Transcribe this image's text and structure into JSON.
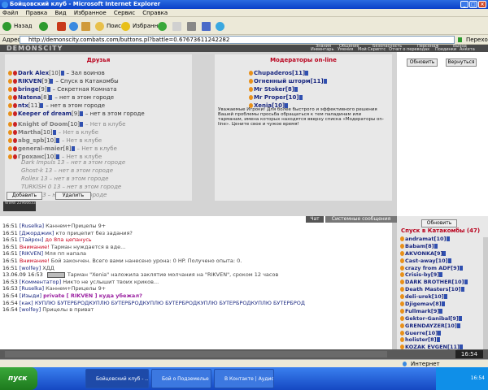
{
  "window": {
    "title": "Бойцовский клуб - Microsoft Internet Explorer"
  },
  "menu": [
    "Файл",
    "Правка",
    "Вид",
    "Избранное",
    "Сервис",
    "Справка"
  ],
  "toolbar": {
    "back": "Назад",
    "search": "Поиск",
    "favorites": "Избранное"
  },
  "address": {
    "label": "Адрес:",
    "url": "http://demonscity.combats.com/buttons.pl?battle=0.67673611242282",
    "go": "Переход"
  },
  "game_header": {
    "logo": "DEMONSCITY",
    "nav_top": [
      "Знания",
      "Общение",
      "Безопасность",
      "Персонаж",
      "Выход"
    ],
    "nav_bottom": [
      "Инвентарь",
      "Умения",
      "Мой Скриптс",
      "Отчет о переводах",
      "Поединки",
      "Анкета"
    ]
  },
  "friends": {
    "title": "Друзья",
    "online": [
      {
        "name": "Dark Alex",
        "lvl": "[10]",
        "loc": "– Зал воинов"
      },
      {
        "name": "RIKVEN",
        "lvl": "[9]",
        "loc": "– Спуск в Катакомбы"
      },
      {
        "name": "bringe",
        "lvl": "[9]",
        "loc": "– Секретная Комната"
      },
      {
        "name": "Natena",
        "lvl": "[8]",
        "loc": "– нет в этом городе"
      },
      {
        "name": "ntx",
        "lvl": "[11]",
        "loc": "– нет в этом городе"
      },
      {
        "name": "Keeper of dream",
        "lvl": "[9]",
        "loc": "– нет в этом городе"
      }
    ],
    "offline": [
      {
        "name": "Knight of Doom",
        "lvl": "[10]",
        "loc": "– Нет в клубе"
      },
      {
        "name": "Martha",
        "lvl": "[10]",
        "loc": "– Нет в клубе"
      },
      {
        "name": "abg_spb",
        "lvl": "[10]",
        "loc": "– Нет в клубе"
      },
      {
        "name": "general-maier",
        "lvl": "[8]",
        "loc": "– Нет в клубе"
      },
      {
        "name": "Гроханс",
        "lvl": "[10]",
        "loc": "– Нет в клубе"
      }
    ],
    "other": [
      {
        "name": "Dark Impuls",
        "lvl": " 13",
        "loc": "– нет в этом городе"
      },
      {
        "name": "Ghost-k",
        "lvl": " 13",
        "loc": "– нет в этом городе"
      },
      {
        "name": "Rollex",
        "lvl": " 13",
        "loc": "– нет в этом городе"
      },
      {
        "name": "TURKISH",
        "lvl": " 0 13",
        "loc": "– нет в этом городе"
      },
      {
        "name": "Zinok",
        "lvl": " 13",
        "loc": "– нет в этом городе"
      }
    ],
    "add_button": "Добавить",
    "remove_button": "Удалить",
    "counter": "WWW 22966633"
  },
  "moderators": {
    "title": "Модераторы on-line",
    "list": [
      "Chupaderos[11]",
      "Огненный шторм[11]",
      "Mr Stoker[8]",
      "Mr Proper[10]",
      "Xenia[10]"
    ],
    "note": "Уважаемые Игроки! Для более быстрого и эффективного решения Вашей проблемы просьба обращаться к тем паладинам или тарманам, имена которых находятся вверху списка «Модераторы on-line». Цените свое и чужое время!",
    "refresh_button": "Обновить",
    "back_button": "Вернуться"
  },
  "tabs": {
    "chat": "Чат",
    "system": "Системные сообщения"
  },
  "chat": [
    {
      "time": "16:51",
      "sender": "[Ruselka]",
      "text": "Каннем+Прицелы 9+",
      "kind": "normal"
    },
    {
      "time": "16:51",
      "sender": "[Джорджик]",
      "text": "кто прицепит без задания?",
      "kind": "normal"
    },
    {
      "time": "16:51",
      "sender": "[Тайрон]",
      "text": "до 8па цепанусь",
      "kind": "red"
    },
    {
      "time": "16:51",
      "sender": "Внимание!",
      "text": "Тарман нуждается в вде...",
      "kind": "attn"
    },
    {
      "time": "16:51",
      "sender": "[RIKVEN]",
      "text": "Мля пп напала",
      "kind": "normal"
    },
    {
      "time": "16:51",
      "sender": "Внимание!",
      "text": "Бой закончен. Всего вами нанесено урона: 0 HP. Получено опыта: 0.",
      "kind": "attn"
    },
    {
      "time": "16:51",
      "sender": "[wolfey]",
      "text": "ХДД",
      "kind": "normal"
    },
    {
      "time": "13.06.09 16:53",
      "sender": "",
      "text": "Тарман \"Xenia\" наложила заклятие молчания на \"RIKVEN\", сроком 12 часов",
      "kind": "sys"
    },
    {
      "time": "16:53",
      "sender": "[Комментатор]",
      "text": "Никто не услышит твоих криков...",
      "kind": "normal"
    },
    {
      "time": "16:53",
      "sender": "[Ruselka]",
      "text": "Каннем+Прицелы 9+",
      "kind": "normal"
    },
    {
      "time": "16:54",
      "sender": "[Изыди]",
      "text": "private [ RIKVEN ] куда убежал?",
      "kind": "priv"
    },
    {
      "time": "16:54",
      "sender": "[как]",
      "text": "КУПЛЮ БУТЕРБРОДКУПЛЮ БУТЕРБРОДКУПЛЮ БУТЕРБРОДКУПЛЮ БУТЕРБРОДКУПЛЮ БУТЕРБРОД",
      "kind": "blue"
    },
    {
      "time": "16:54",
      "sender": "[wolfey]",
      "text": "Прицелы в приват",
      "kind": "normal"
    }
  ],
  "sidebar": {
    "refresh": "Обновить",
    "title": "Спуск в Катакомбы (47)",
    "users": [
      "andramat[10]",
      "Babam[8]",
      "AKVONKA[9]",
      "Cast-away[10]",
      "crazy from ADF[9]",
      "Crisis-by[9]",
      "DARK BROTHER[10]",
      "Death Masters[10]",
      "deli-urek[10]",
      "Djigemav[8]",
      "Fullmark[9]",
      "Gektor-Ganibal[9]",
      "GRENDAYZER[10]",
      "Guerre[10]",
      "holister[8]",
      "KOZAK EVGEN[11]",
      "Playboy-Tova[8]"
    ]
  },
  "bottom_bar": {
    "time": "16:54"
  },
  "status": {
    "zone": "Интернет"
  },
  "taskbar": {
    "start": "пуск",
    "tasks": [
      "Бойцовский клуб - ...",
      "Бой о Подземелье ...",
      "В Контакте | Аудио ..."
    ],
    "lang": "RU",
    "clock": "16:54"
  }
}
